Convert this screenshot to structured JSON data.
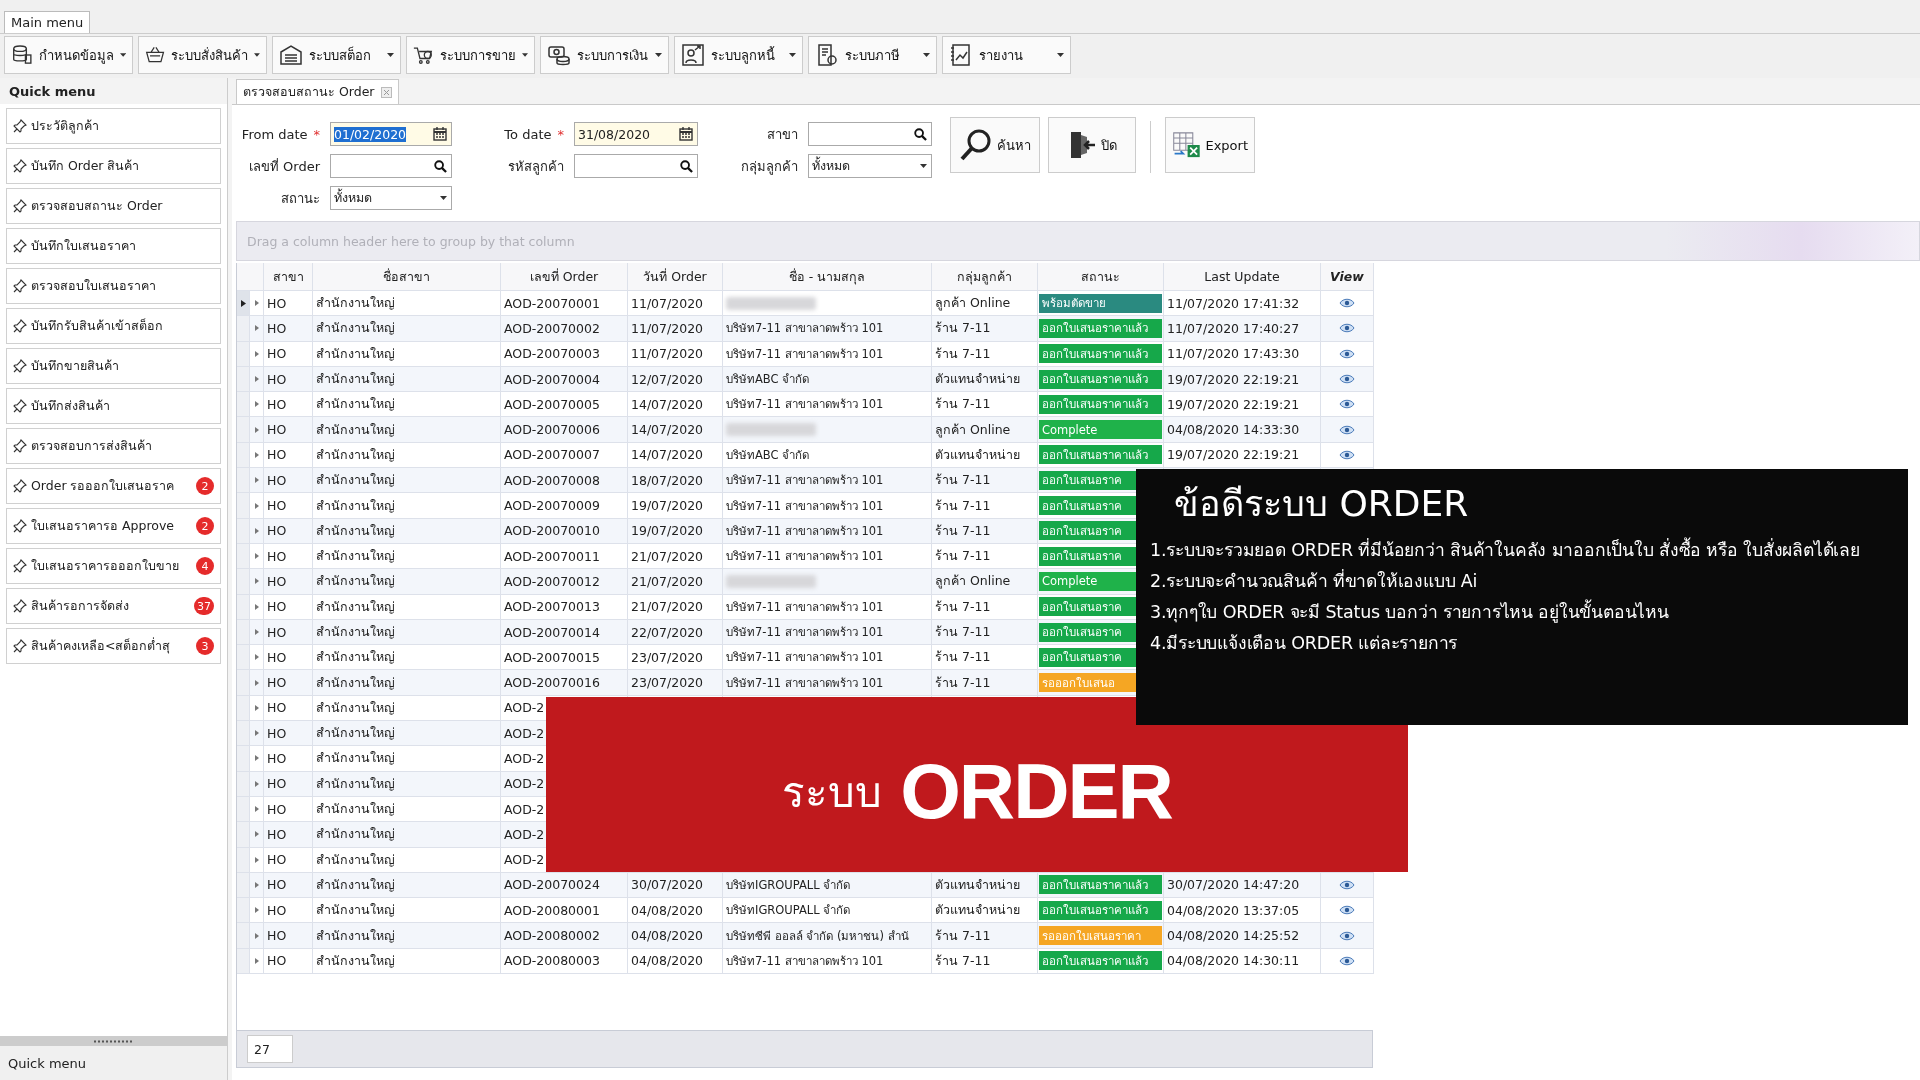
{
  "main_menu_tab": "Main menu",
  "toolbar": [
    "กำหนดข้อมูล",
    "ระบบสั่งสินค้า",
    "ระบบสต็อก",
    "ระบบการขาย",
    "ระบบการเงิน",
    "ระบบลูกหนี้",
    "ระบบภาษี",
    "รายงาน"
  ],
  "quick_menu": {
    "title": "Quick menu",
    "items": [
      {
        "label": "ประวัติลูกค้า"
      },
      {
        "label": "บันทึก Order สินค้า"
      },
      {
        "label": "ตรวจสอบสถานะ Order"
      },
      {
        "label": "บันทึกใบเสนอราคา"
      },
      {
        "label": "ตรวจสอบใบเสนอราคา"
      },
      {
        "label": "บันทึกรับสินค้าเข้าสต็อก"
      },
      {
        "label": "บันทึกขายสินค้า"
      },
      {
        "label": "บันทึกส่งสินค้า"
      },
      {
        "label": "ตรวจสอบการส่งสินค้า"
      },
      {
        "label": "Order รอออกใบเสนอราค",
        "count": "2"
      },
      {
        "label": "ใบเสนอราคารอ Approve",
        "count": "2"
      },
      {
        "label": "ใบเสนอราคารอออกใบขาย",
        "count": "4"
      },
      {
        "label": "สินค้ารอการจัดส่ง",
        "count": "37"
      },
      {
        "label": "สินค้าคงเหลือ<สต็อกต่ำสุ",
        "count": "3"
      }
    ],
    "footer": "Quick menu"
  },
  "document_tab": {
    "label": "ตรวจสอบสถานะ Order",
    "selected": true
  },
  "form": {
    "fields": [
      {
        "label": "From date",
        "required_mark": "*",
        "kind": "date",
        "value": "01/02/2020",
        "value_selected": true
      },
      {
        "label": "To date",
        "required_mark": "*",
        "kind": "date",
        "value": "31/08/2020",
        "value_selected": false
      },
      {
        "label": "สาขา",
        "kind": "search"
      },
      {
        "label": "เลขที่ Order",
        "kind": "search"
      },
      {
        "label": "รหัสลูกค้า",
        "kind": "search"
      },
      {
        "label": "กลุ่มลูกค้า",
        "kind": "combo",
        "value": "ทั้งหมด"
      },
      {
        "label": "สถานะ",
        "kind": "combo",
        "value": "ทั้งหมด"
      }
    ],
    "buttons": [
      "ค้นหา",
      "ปิด",
      "Export"
    ]
  },
  "group_hint": "Drag a column header here to group by that column",
  "grid": {
    "columns": [
      "สาขา",
      "ชื่อสาขา",
      "เลขที่ Order",
      "วันที่ Order",
      "ชื่อ - นามสกุล",
      "กลุ่มลูกค้า",
      "สถานะ",
      "Last Update",
      "View"
    ],
    "rows": [
      {
        "selected": true,
        "branch": "HO",
        "branch_name": "สำนักงานใหญ่",
        "order_no": "AOD-20070001",
        "order_date": "11/07/2020",
        "customer_redacted": true,
        "group": "ลูกค้า Online",
        "status": {
          "label": "พร้อมตัดขาย",
          "color": "#2a8a80"
        },
        "last_update": "11/07/2020 17:41:32",
        "viewable": true
      },
      {
        "selected": false,
        "branch": "HO",
        "branch_name": "สำนักงานใหญ่",
        "order_no": "AOD-20070002",
        "order_date": "11/07/2020",
        "customer": "บริษัท7-11 สาขาลาดพร้าว 101",
        "group": "ร้าน 7-11",
        "status": {
          "label": "ออกใบเสนอราคาแล้ว",
          "color": "#16a84a"
        },
        "last_update": "11/07/2020 17:40:27",
        "viewable": true
      },
      {
        "selected": false,
        "branch": "HO",
        "branch_name": "สำนักงานใหญ่",
        "order_no": "AOD-20070003",
        "order_date": "11/07/2020",
        "customer": "บริษัท7-11 สาขาลาดพร้าว 101",
        "group": "ร้าน 7-11",
        "status": {
          "label": "ออกใบเสนอราคาแล้ว",
          "color": "#16a84a"
        },
        "last_update": "11/07/2020 17:43:30",
        "viewable": true
      },
      {
        "selected": false,
        "branch": "HO",
        "branch_name": "สำนักงานใหญ่",
        "order_no": "AOD-20070004",
        "order_date": "12/07/2020",
        "customer": "บริษัทABC จำกัด",
        "group": "ตัวแทนจำหน่าย",
        "status": {
          "label": "ออกใบเสนอราคาแล้ว",
          "color": "#16a84a"
        },
        "last_update": "19/07/2020 22:19:21",
        "viewable": true
      },
      {
        "selected": false,
        "branch": "HO",
        "branch_name": "สำนักงานใหญ่",
        "order_no": "AOD-20070005",
        "order_date": "14/07/2020",
        "customer": "บริษัท7-11 สาขาลาดพร้าว 101",
        "group": "ร้าน 7-11",
        "status": {
          "label": "ออกใบเสนอราคาแล้ว",
          "color": "#16a84a"
        },
        "last_update": "19/07/2020 22:19:21",
        "viewable": true
      },
      {
        "selected": false,
        "branch": "HO",
        "branch_name": "สำนักงานใหญ่",
        "order_no": "AOD-20070006",
        "order_date": "14/07/2020",
        "customer_redacted": true,
        "group": "ลูกค้า Online",
        "status": {
          "label": "Complete",
          "color": "#1fb24a"
        },
        "last_update": "04/08/2020 14:33:30",
        "viewable": true
      },
      {
        "selected": false,
        "branch": "HO",
        "branch_name": "สำนักงานใหญ่",
        "order_no": "AOD-20070007",
        "order_date": "14/07/2020",
        "customer": "บริษัทABC จำกัด",
        "group": "ตัวแทนจำหน่าย",
        "status": {
          "label": "ออกใบเสนอราคาแล้ว",
          "color": "#16a84a"
        },
        "last_update": "19/07/2020 22:19:21",
        "viewable": true
      },
      {
        "selected": false,
        "branch": "HO",
        "branch_name": "สำนักงานใหญ่",
        "order_no": "AOD-20070008",
        "order_date": "18/07/2020",
        "customer": "บริษัท7-11 สาขาลาดพร้าว 101",
        "group": "ร้าน 7-11",
        "status": {
          "label": "ออกใบเสนอราค",
          "color": "#16a84a"
        }
      },
      {
        "selected": false,
        "branch": "HO",
        "branch_name": "สำนักงานใหญ่",
        "order_no": "AOD-20070009",
        "order_date": "19/07/2020",
        "customer": "บริษัท7-11 สาขาลาดพร้าว 101",
        "group": "ร้าน 7-11",
        "status": {
          "label": "ออกใบเสนอราค",
          "color": "#16a84a"
        }
      },
      {
        "selected": false,
        "branch": "HO",
        "branch_name": "สำนักงานใหญ่",
        "order_no": "AOD-20070010",
        "order_date": "19/07/2020",
        "customer": "บริษัท7-11 สาขาลาดพร้าว 101",
        "group": "ร้าน 7-11",
        "status": {
          "label": "ออกใบเสนอราค",
          "color": "#16a84a"
        }
      },
      {
        "selected": false,
        "branch": "HO",
        "branch_name": "สำนักงานใหญ่",
        "order_no": "AOD-20070011",
        "order_date": "21/07/2020",
        "customer": "บริษัท7-11 สาขาลาดพร้าว 101",
        "group": "ร้าน 7-11",
        "status": {
          "label": "ออกใบเสนอราค",
          "color": "#16a84a"
        }
      },
      {
        "selected": false,
        "branch": "HO",
        "branch_name": "สำนักงานใหญ่",
        "order_no": "AOD-20070012",
        "order_date": "21/07/2020",
        "customer_redacted": true,
        "group": "ลูกค้า Online",
        "status": {
          "label": "Complete",
          "color": "#1fb24a"
        }
      },
      {
        "selected": false,
        "branch": "HO",
        "branch_name": "สำนักงานใหญ่",
        "order_no": "AOD-20070013",
        "order_date": "21/07/2020",
        "customer": "บริษัท7-11 สาขาลาดพร้าว 101",
        "group": "ร้าน 7-11",
        "status": {
          "label": "ออกใบเสนอราค",
          "color": "#16a84a"
        }
      },
      {
        "selected": false,
        "branch": "HO",
        "branch_name": "สำนักงานใหญ่",
        "order_no": "AOD-20070014",
        "order_date": "22/07/2020",
        "customer": "บริษัท7-11 สาขาลาดพร้าว 101",
        "group": "ร้าน 7-11",
        "status": {
          "label": "ออกใบเสนอราค",
          "color": "#16a84a"
        }
      },
      {
        "selected": false,
        "branch": "HO",
        "branch_name": "สำนักงานใหญ่",
        "order_no": "AOD-20070015",
        "order_date": "23/07/2020",
        "customer": "บริษัท7-11 สาขาลาดพร้าว 101",
        "group": "ร้าน 7-11",
        "status": {
          "label": "ออกใบเสนอราค",
          "color": "#16a84a"
        }
      },
      {
        "selected": false,
        "branch": "HO",
        "branch_name": "สำนักงานใหญ่",
        "order_no": "AOD-20070016",
        "order_date": "23/07/2020",
        "customer": "บริษัท7-11 สาขาลาดพร้าว 101",
        "group": "ร้าน 7-11",
        "status": {
          "label": "รอออกใบเสนอ",
          "color": "#f5a623"
        }
      },
      {
        "selected": false,
        "branch": "HO",
        "branch_name": "สำนักงานใหญ่",
        "order_no": "AOD-2"
      },
      {
        "selected": false,
        "branch": "HO",
        "branch_name": "สำนักงานใหญ่",
        "order_no": "AOD-2"
      },
      {
        "selected": false,
        "branch": "HO",
        "branch_name": "สำนักงานใหญ่",
        "order_no": "AOD-2"
      },
      {
        "selected": false,
        "branch": "HO",
        "branch_name": "สำนักงานใหญ่",
        "order_no": "AOD-2"
      },
      {
        "selected": false,
        "branch": "HO",
        "branch_name": "สำนักงานใหญ่",
        "order_no": "AOD-2"
      },
      {
        "selected": false,
        "branch": "HO",
        "branch_name": "สำนักงานใหญ่",
        "order_no": "AOD-2"
      },
      {
        "selected": false,
        "branch": "HO",
        "branch_name": "สำนักงานใหญ่",
        "order_no": "AOD-2"
      },
      {
        "selected": false,
        "branch": "HO",
        "branch_name": "สำนักงานใหญ่",
        "order_no": "AOD-20070024",
        "order_date": "30/07/2020",
        "customer": "บริษัทIGROUPALL จำกัด",
        "group": "ตัวแทนจำหน่าย",
        "status": {
          "label": "ออกใบเสนอราคาแล้ว",
          "color": "#16a84a"
        },
        "last_update": "30/07/2020 14:47:20",
        "viewable": true
      },
      {
        "selected": false,
        "branch": "HO",
        "branch_name": "สำนักงานใหญ่",
        "order_no": "AOD-20080001",
        "order_date": "04/08/2020",
        "customer": "บริษัทIGROUPALL จำกัด",
        "group": "ตัวแทนจำหน่าย",
        "status": {
          "label": "ออกใบเสนอราคาแล้ว",
          "color": "#16a84a"
        },
        "last_update": "04/08/2020 13:37:05",
        "viewable": true
      },
      {
        "selected": false,
        "branch": "HO",
        "branch_name": "สำนักงานใหญ่",
        "order_no": "AOD-20080002",
        "order_date": "04/08/2020",
        "customer": "บริษัทซีพี ออลล์ จำกัด (มหาชน) สำนั",
        "group": "ร้าน 7-11",
        "status": {
          "label": "รอออกใบเสนอราคา",
          "color": "#f5a623"
        },
        "last_update": "04/08/2020 14:25:52",
        "viewable": true
      },
      {
        "selected": false,
        "branch": "HO",
        "branch_name": "สำนักงานใหญ่",
        "order_no": "AOD-20080003",
        "order_date": "04/08/2020",
        "customer": "บริษัท7-11 สาขาลาดพร้าว 101",
        "group": "ร้าน 7-11",
        "status": {
          "label": "ออกใบเสนอราคาแล้ว",
          "color": "#16a84a"
        },
        "last_update": "04/08/2020 14:30:11",
        "viewable": true
      }
    ],
    "row_count": "27"
  },
  "advantages_panel": {
    "title": "ข้อดีระบบ ORDER",
    "points": [
      "1.ระบบจะรวมยอด ORDER ที่มีน้อยกว่า สินค้าในคลัง มาออกเป็นใบ สั่งซื้อ หรือ ใบสั่งผลิตได้เลย",
      "2.ระบบจะคำนวณสินค้า ที่ขาดให้เองแบบ Ai",
      "3.ทุกๆใบ ORDER จะมี Status บอกว่า รายการไหน อยู่ในขั้นตอนไหน",
      "4.มีระบบแจ้งเตือน ORDER แต่ละรายการ"
    ]
  },
  "banner": {
    "prefix": "ระบบ",
    "title": "ORDER"
  }
}
